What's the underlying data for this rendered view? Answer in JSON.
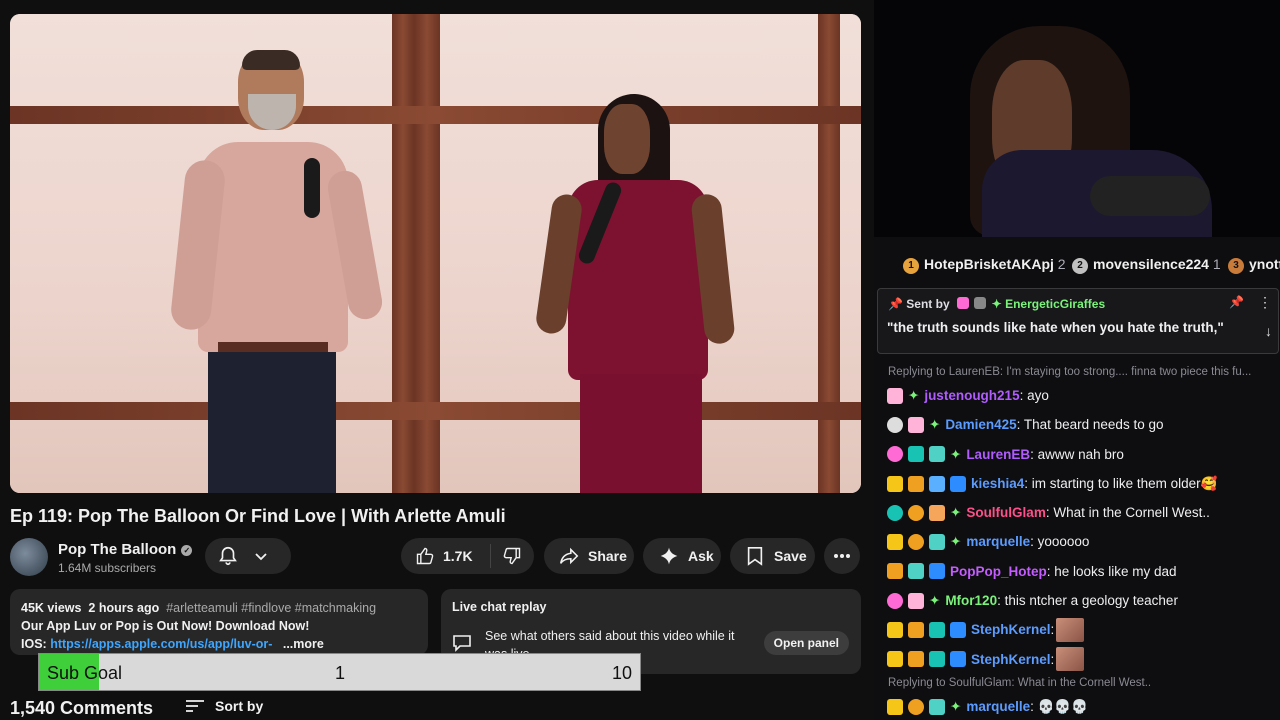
{
  "video": {
    "title": "Ep 119: Pop The Balloon Or Find Love | With Arlette Amuli"
  },
  "channel": {
    "name": "Pop The Balloon",
    "subscribers": "1.64M subscribers",
    "verified_mark": "✓"
  },
  "actions": {
    "likes": "1.7K",
    "share": "Share",
    "ask": "Ask",
    "save": "Save"
  },
  "description": {
    "views": "45K views",
    "age": "2 hours ago",
    "hashtags": "#arletteamuli #findlove #matchmaking",
    "line2": "Our App Luv or Pop is Out Now! Download Now!",
    "ios_label": "IOS:",
    "link": "https://apps.apple.com/us/app/luv-or-",
    "more": "...more"
  },
  "live_chat_replay": {
    "title": "Live chat replay",
    "body": "See what others said about this video while it was live.",
    "button": "Open panel"
  },
  "sub_goal": {
    "label": "Sub Goal",
    "current": "1",
    "target": "10",
    "progress_fraction": 0.1
  },
  "comments": {
    "count": "1,540 Comments",
    "sort": "Sort by"
  },
  "leaderboard": [
    {
      "rank": "1",
      "name": "HotepBrisketAKApj",
      "count": "2",
      "color": "#e6a23c"
    },
    {
      "rank": "2",
      "name": "movensilence224",
      "count": "1",
      "color": "#c0c0c0"
    },
    {
      "rank": "3",
      "name": "ynott",
      "count": "",
      "color": "#c97b3a"
    }
  ],
  "pinned": {
    "sent_by": "Sent by",
    "user": "EnergeticGiraffes",
    "message": "\"the truth sounds like hate when you hate the truth,\""
  },
  "chat": {
    "reply1": "Replying to LaurenEB: I'm staying too strong.... finna two piece this fu...",
    "reply2": "Replying to SoulfulGlam: What in the Cornell West..",
    "messages": [
      {
        "user": "justenough215",
        "color": "#b05cff",
        "text": ": ayo"
      },
      {
        "user": "Damien425",
        "color": "#5c9cff",
        "text": ": That beard needs to go"
      },
      {
        "user": "LaurenEB",
        "color": "#b05cff",
        "text": ": awww nah bro"
      },
      {
        "user": "kieshia4",
        "color": "#5c9cff",
        "text": ": im starting to like them older🥰"
      },
      {
        "user": "SoulfulGlam",
        "color": "#ff4f8b",
        "text": ": What in the Cornell West.."
      },
      {
        "user": "marquelle",
        "color": "#5c9cff",
        "text": ": yoooooo"
      },
      {
        "user": "PopPop_Hotep",
        "color": "#c45cff",
        "text": ": he looks like my dad"
      },
      {
        "user": "Mfor120",
        "color": "#7af37a",
        "text": ": this ntcher a geology teacher"
      },
      {
        "user": "StephKernel",
        "color": "#5c9cff",
        "text": ":"
      },
      {
        "user": "StephKernel",
        "color": "#5c9cff",
        "text": ":"
      },
      {
        "user": "marquelle",
        "color": "#5c9cff",
        "text": ": 💀💀💀"
      }
    ]
  }
}
